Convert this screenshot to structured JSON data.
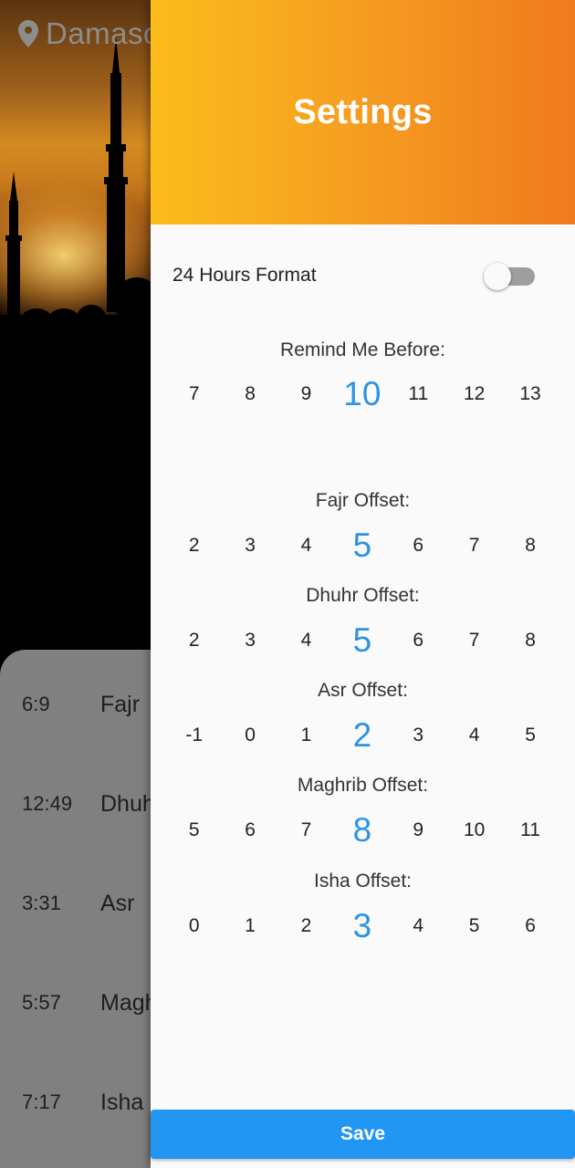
{
  "location": {
    "city": "Damascus",
    "icon": "location-pin-icon"
  },
  "prayers": [
    {
      "time": "6:9",
      "name": "Fajr"
    },
    {
      "time": "12:49",
      "name": "Dhuhr"
    },
    {
      "time": "3:31",
      "name": "Asr"
    },
    {
      "time": "5:57",
      "name": "Maghrib"
    },
    {
      "time": "7:17",
      "name": "Isha"
    }
  ],
  "drawer": {
    "title": "Settings",
    "format_label": "24 Hours Format",
    "format_enabled": false,
    "save_label": "Save"
  },
  "pickers": [
    {
      "label": "Remind Me Before:",
      "values": [
        "7",
        "8",
        "9",
        "10",
        "11",
        "12",
        "13"
      ],
      "selected": "10"
    },
    {
      "label": "Fajr Offset:",
      "values": [
        "2",
        "3",
        "4",
        "5",
        "6",
        "7",
        "8"
      ],
      "selected": "5"
    },
    {
      "label": "Dhuhr Offset:",
      "values": [
        "2",
        "3",
        "4",
        "5",
        "6",
        "7",
        "8"
      ],
      "selected": "5"
    },
    {
      "label": "Asr Offset:",
      "values": [
        "-1",
        "0",
        "1",
        "2",
        "3",
        "4",
        "5"
      ],
      "selected": "2"
    },
    {
      "label": "Maghrib Offset:",
      "values": [
        "5",
        "6",
        "7",
        "8",
        "9",
        "10",
        "11"
      ],
      "selected": "8"
    },
    {
      "label": "Isha Offset:",
      "values": [
        "0",
        "1",
        "2",
        "3",
        "4",
        "5",
        "6"
      ],
      "selected": "3"
    }
  ],
  "colors": {
    "header_start": "#fbbd1b",
    "header_end": "#ef7a1e",
    "selected_value": "#2e93e2",
    "save_button": "#2196f3"
  }
}
